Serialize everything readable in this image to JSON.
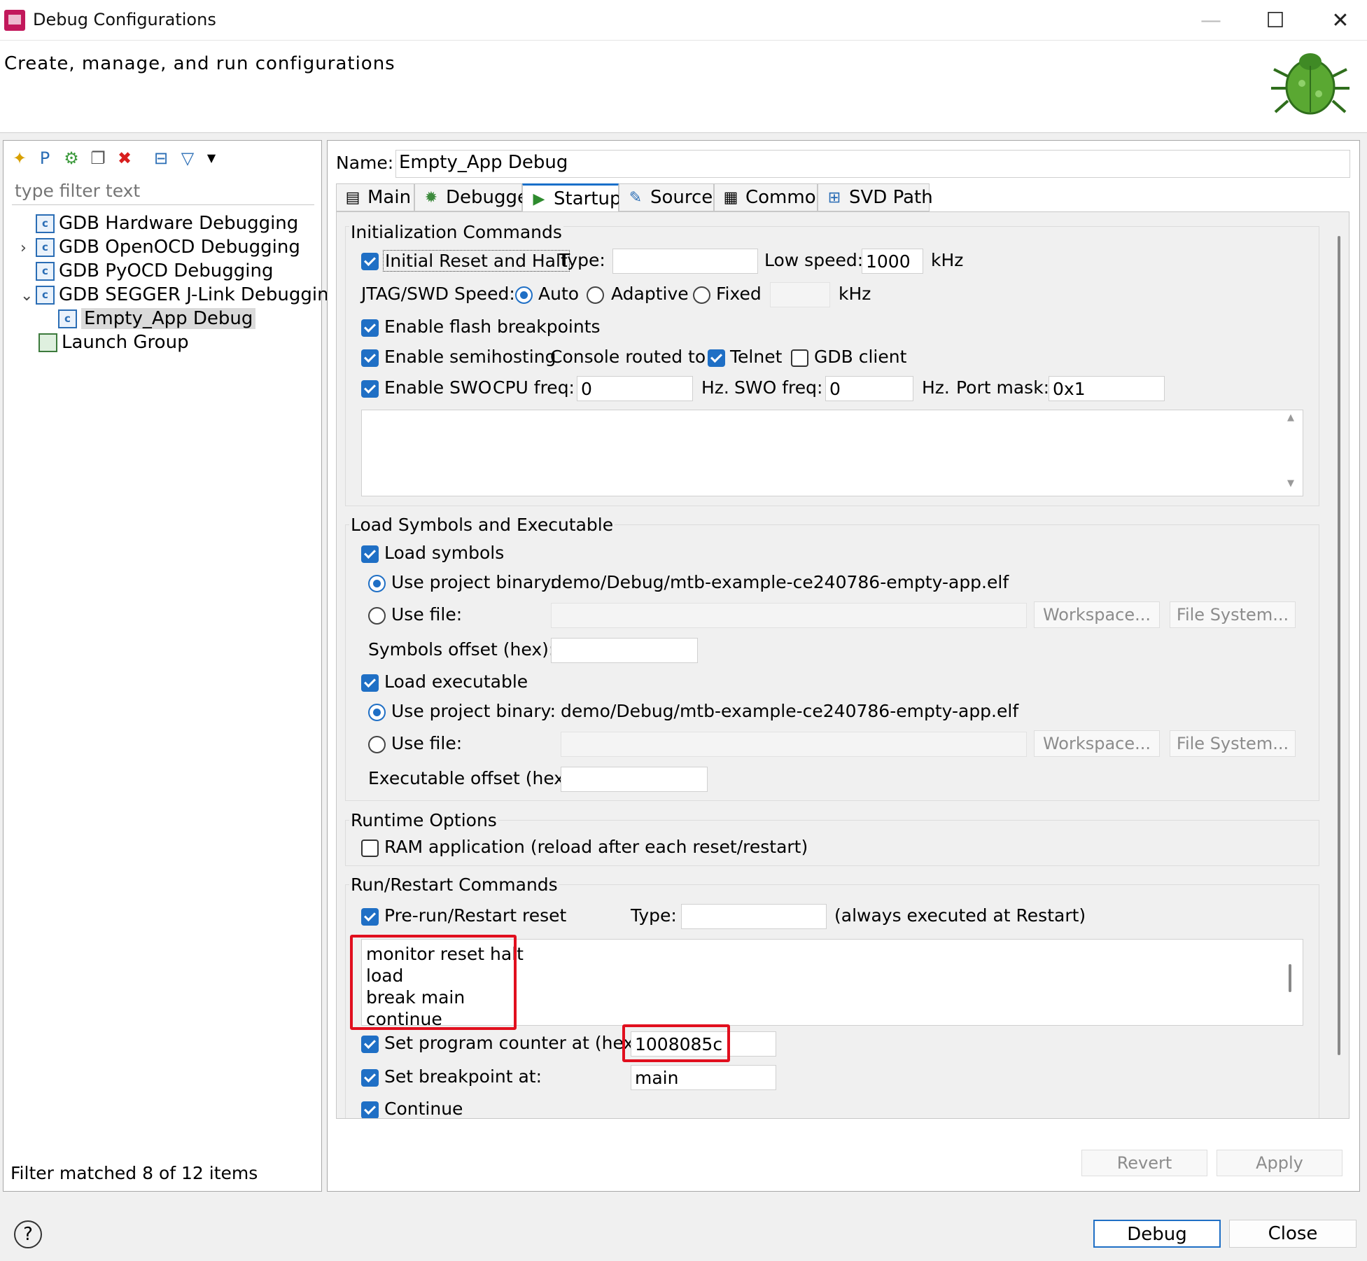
{
  "window": {
    "title": "Debug Configurations",
    "minimize": "—",
    "maximize": "☐",
    "close": "✕"
  },
  "header": {
    "subtitle": "Create, manage, and run configurations"
  },
  "left": {
    "filter_placeholder": "type filter text",
    "tree": [
      {
        "label": "GDB Hardware Debugging",
        "icon": "c"
      },
      {
        "label": "GDB OpenOCD Debugging",
        "icon": "c",
        "twisty": "›"
      },
      {
        "label": "GDB PyOCD Debugging",
        "icon": "c"
      },
      {
        "label": "GDB SEGGER J-Link Debugging",
        "icon": "c",
        "twisty": "⌄"
      },
      {
        "label": "Empty_App Debug",
        "icon": "c"
      },
      {
        "label": "Launch Group",
        "icon": "launch-group"
      }
    ],
    "filter_message": "Filter matched 8 of 12 items"
  },
  "config": {
    "name_label": "Name:",
    "name_value": "Empty_App Debug",
    "tabs": [
      "Main",
      "Debugger",
      "Startup",
      "Source",
      "Common",
      "SVD Path"
    ],
    "active_tab": "Startup"
  },
  "init": {
    "title": "Initialization Commands",
    "initial_reset": "Initial Reset and Halt",
    "type_label": "Type:",
    "type_value": "",
    "low_speed_label": "Low speed:",
    "low_speed_value": "1000",
    "khz": "kHz",
    "jtag_label": "JTAG/SWD Speed:",
    "auto": "Auto",
    "adaptive": "Adaptive",
    "fixed": "Fixed",
    "fixed_value": "",
    "khz2": "kHz",
    "flash_bp": "Enable flash breakpoints",
    "semihosting": "Enable semihosting",
    "console_routed": "Console routed to:",
    "telnet": "Telnet",
    "gdb_client": "GDB client",
    "swo": "Enable SWO",
    "cpu_freq_label": "CPU freq:",
    "cpu_freq_value": "0",
    "hz1": "Hz.",
    "swo_freq_label": "SWO freq:",
    "swo_freq_value": "0",
    "hz2": "Hz.",
    "port_mask_label": "Port mask:",
    "port_mask_value": "0x1"
  },
  "load": {
    "title": "Load Symbols and Executable",
    "load_symbols": "Load symbols",
    "use_project_binary": "Use project binary:",
    "symbols_binary": "demo/Debug/mtb-example-ce240786-empty-app.elf",
    "use_file": "Use file:",
    "workspace": "Workspace...",
    "file_system": "File System...",
    "symbols_offset": "Symbols offset (hex):",
    "load_executable": "Load executable",
    "use_project_binary2": "Use project binary:",
    "exec_binary": "demo/Debug/mtb-example-ce240786-empty-app.elf",
    "use_file2": "Use file:",
    "workspace2": "Workspace...",
    "file_system2": "File System...",
    "exec_offset": "Executable offset (hex):"
  },
  "runtime": {
    "title": "Runtime Options",
    "ram_app": "RAM application (reload after each reset/restart)"
  },
  "run": {
    "title": "Run/Restart Commands",
    "prerun": "Pre-run/Restart reset",
    "type_label": "Type:",
    "type_value": "",
    "always": "(always executed at Restart)",
    "commands": [
      "monitor reset halt",
      "load",
      "break main",
      "continue"
    ],
    "set_pc": "Set program counter at (hex):",
    "pc_value": "1008085c",
    "set_bp": "Set breakpoint at:",
    "bp_value": "main",
    "continue": "Continue"
  },
  "actions": {
    "revert": "Revert",
    "apply": "Apply",
    "debug": "Debug",
    "close": "Close",
    "help": "?"
  }
}
